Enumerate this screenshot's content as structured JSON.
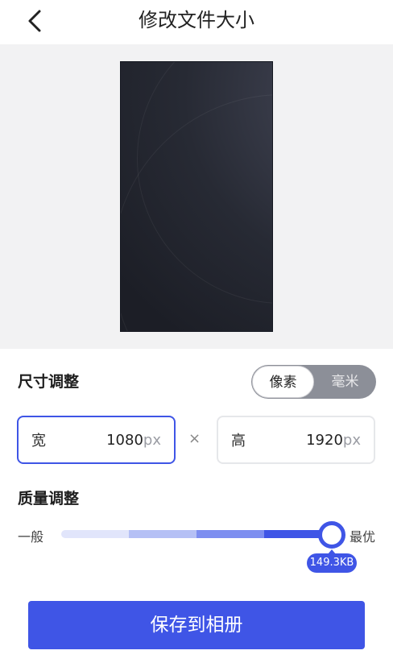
{
  "header": {
    "title": "修改文件大小",
    "back_icon": "chevron-left-icon"
  },
  "size_section": {
    "title": "尺寸调整",
    "unit_options": [
      "像素",
      "毫米"
    ],
    "selected_unit": "像素",
    "width": {
      "label": "宽",
      "value": "1080",
      "unit": "px"
    },
    "height": {
      "label": "高",
      "value": "1920",
      "unit": "px"
    },
    "separator": "×"
  },
  "quality_section": {
    "title": "质量调整",
    "min_label": "一般",
    "max_label": "最优",
    "level": 1.0,
    "size_readout": "149.3KB",
    "segment_colors": [
      "#e1e5fb",
      "#b5c0f5",
      "#7d8ef0",
      "#3f55e6"
    ]
  },
  "save_button": {
    "label": "保存到相册"
  },
  "colors": {
    "accent": "#3f55e6",
    "preview_bg": "#f2f2f3"
  }
}
